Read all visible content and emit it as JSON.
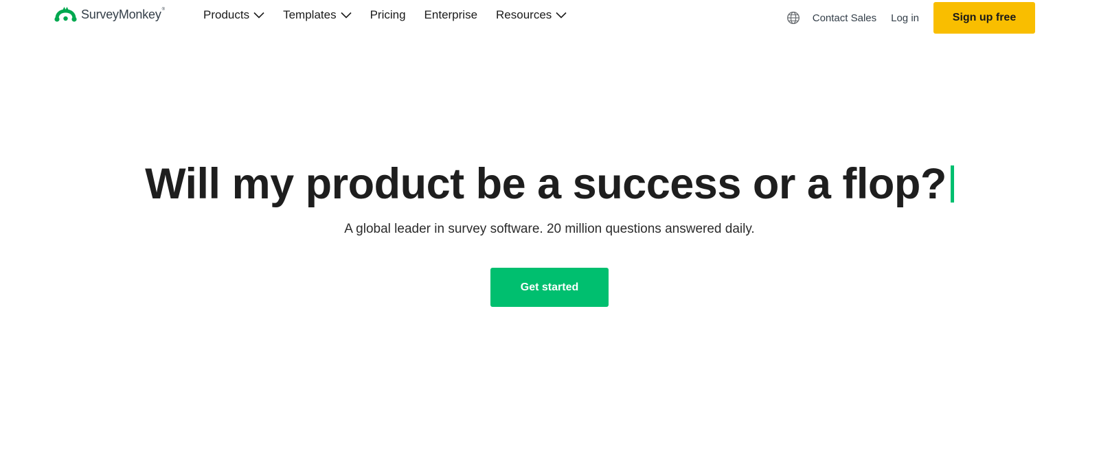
{
  "brand": {
    "name": "SurveyMonkey",
    "trademark": "®",
    "logo_icon": "monkey-logo-icon",
    "logo_color": "#00a84f"
  },
  "nav": {
    "items": [
      {
        "label": "Products",
        "has_dropdown": true
      },
      {
        "label": "Templates",
        "has_dropdown": true
      },
      {
        "label": "Pricing",
        "has_dropdown": false
      },
      {
        "label": "Enterprise",
        "has_dropdown": false
      },
      {
        "label": "Resources",
        "has_dropdown": true
      }
    ],
    "dropdown_icon": "chevron-down-icon"
  },
  "header_right": {
    "language_icon": "globe-icon",
    "contact_sales": "Contact Sales",
    "log_in": "Log in",
    "sign_up": "Sign up free"
  },
  "hero": {
    "title": "Will my product be a success or a flop?",
    "subtitle": "A global leader in survey software. 20 million questions answered daily.",
    "cta": "Get started"
  },
  "colors": {
    "accent_green": "#00bf6f",
    "signup_yellow": "#f9be00",
    "text_dark": "#1e1e1e"
  }
}
